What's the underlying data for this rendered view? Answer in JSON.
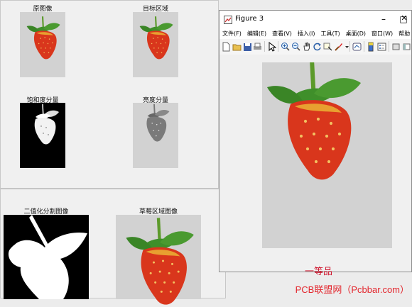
{
  "background_figures": {
    "subplots": [
      {
        "title": "原图像"
      },
      {
        "title": "目标区域"
      },
      {
        "title": "饱和度分量"
      },
      {
        "title": "亮度分量"
      },
      {
        "title": "二值化分割图像"
      },
      {
        "title": "草莓区域图像"
      }
    ]
  },
  "figure_window": {
    "title": "Figure 3",
    "controls": {
      "minimize": "–",
      "maximize": "□",
      "close": "✕"
    },
    "menu": [
      "文件(F)",
      "编辑(E)",
      "查看(V)",
      "插入(I)",
      "工具(T)",
      "桌面(D)",
      "窗口(W)",
      "帮助"
    ],
    "toolbar_icons": [
      "new-figure-icon",
      "open-icon",
      "save-icon",
      "print-icon",
      "pointer-icon",
      "zoom-in-icon",
      "zoom-out-icon",
      "pan-icon",
      "rotate-icon",
      "data-cursor-icon",
      "brush-icon",
      "link-icon",
      "colorbar-icon",
      "legend-icon",
      "hide-plot-tools-icon",
      "show-plot-tools-icon"
    ],
    "result_label": "一等品"
  },
  "watermark": "PCB联盟网（Pcbbar.com）",
  "colors": {
    "result_text": "#d0142c",
    "watermark": "#e3262d",
    "axes_background": "#d2d2d2"
  }
}
